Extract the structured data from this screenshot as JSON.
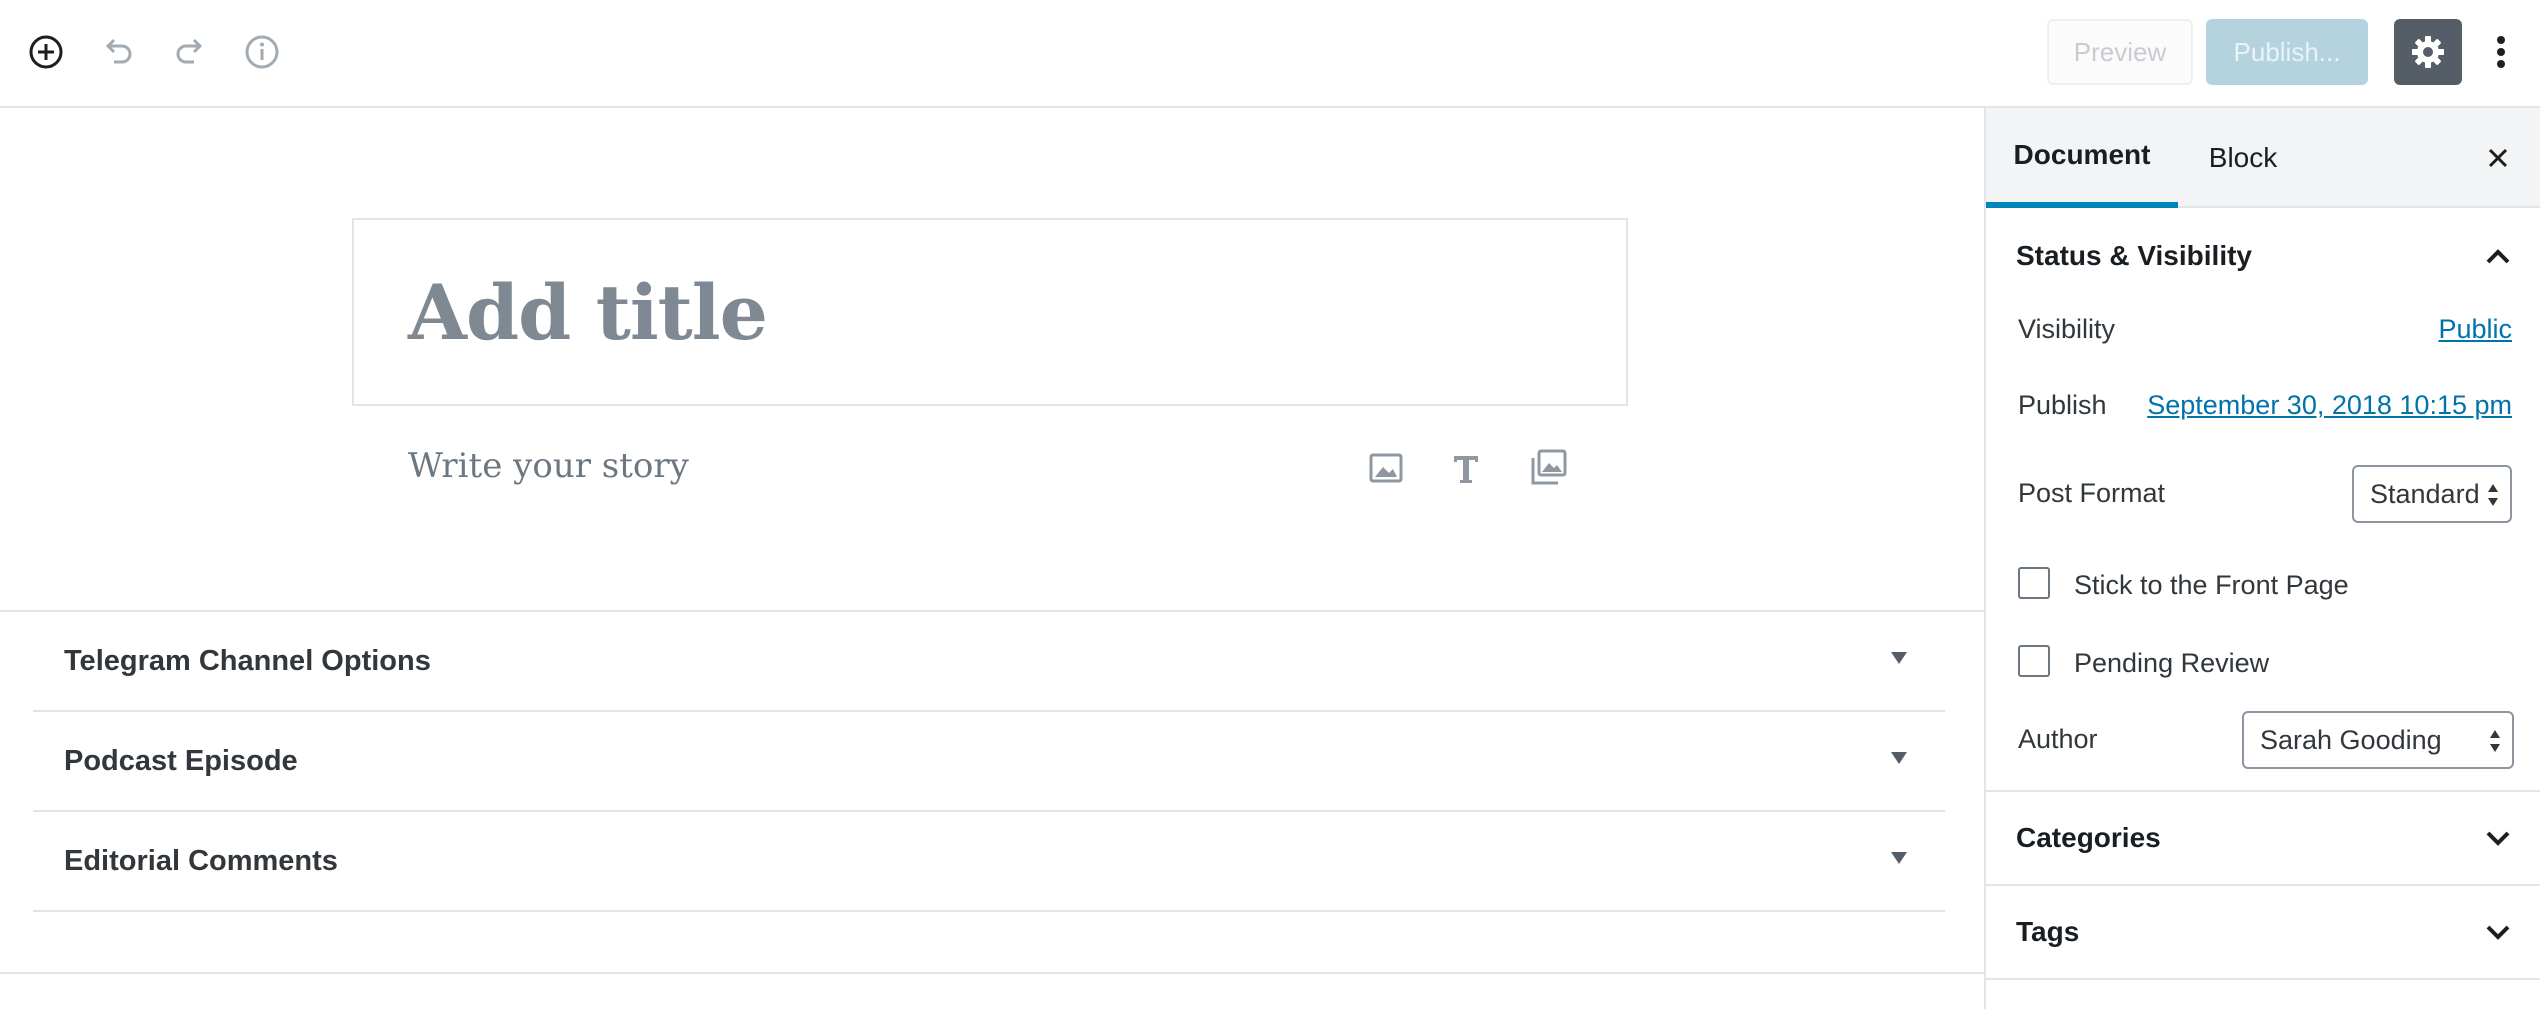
{
  "toolbar": {
    "icons": [
      "add-block-icon",
      "undo-icon",
      "redo-icon",
      "info-icon"
    ],
    "preview_label": "Preview",
    "publish_label": "Publish...",
    "settings_icon": "gear-icon",
    "more_icon": "vertical-ellipsis-icon"
  },
  "editor": {
    "title_placeholder": "Add title",
    "body_placeholder": "Write your story",
    "inserter_icons": [
      "image-icon",
      "heading-icon",
      "gallery-icon"
    ]
  },
  "metaboxes": [
    {
      "label": "Telegram Channel Options"
    },
    {
      "label": "Podcast Episode"
    },
    {
      "label": "Editorial Comments"
    }
  ],
  "sidebar": {
    "tabs": [
      {
        "label": "Document",
        "active": true
      },
      {
        "label": "Block",
        "active": false
      }
    ],
    "status_visibility": {
      "title": "Status & Visibility",
      "visibility_label": "Visibility",
      "visibility_value": "Public",
      "publish_label": "Publish",
      "publish_value": "September 30, 2018 10:15 pm",
      "post_format_label": "Post Format",
      "post_format_value": "Standard",
      "stick_label": "Stick to the Front Page",
      "stick_checked": false,
      "pending_label": "Pending Review",
      "pending_checked": false,
      "author_label": "Author",
      "author_value": "Sarah Gooding"
    },
    "categories_title": "Categories",
    "tags_title": "Tags"
  },
  "colors": {
    "accent": "#0085ba",
    "link": "#0073aa",
    "publish_disabled_bg": "#b5d3df",
    "settings_bg": "#555d66"
  }
}
